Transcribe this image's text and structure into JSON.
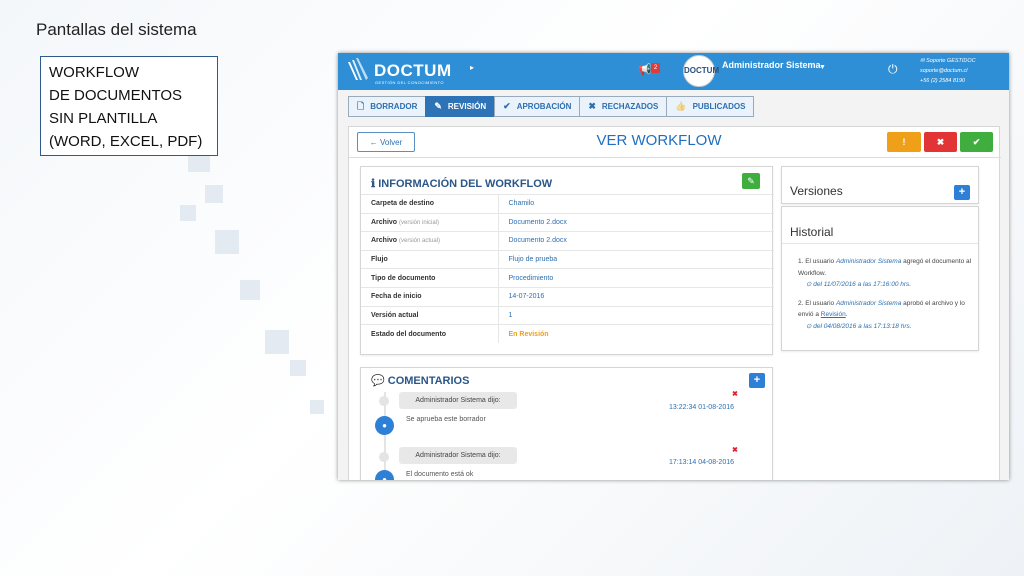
{
  "slide": {
    "title": "Pantallas del sistema",
    "caption": [
      "WORKFLOW",
      "DE DOCUMENTOS",
      "SIN PLANTILLA",
      "(WORD, EXCEL, PDF)"
    ]
  },
  "navbar": {
    "logo_text": "DOCTUM",
    "logo_sub": "GESTIÓN DEL CONOCIMIENTO",
    "notification_count": "2",
    "avatar_text": "DOCTUM",
    "user_name": "Administrador Sistema",
    "support_title": "Soporte GESTIDOC",
    "support_email": "soporte@doctum.cl",
    "support_phone": "+56 (2) 2584 8190",
    "color": "#2e8fd6"
  },
  "tabs": [
    {
      "label": "BORRADOR",
      "icon": "file-icon",
      "glyph": "🗋"
    },
    {
      "label": "REVISIÓN",
      "icon": "edit-icon",
      "glyph": "✎"
    },
    {
      "label": "APROBACIÓN",
      "icon": "check-icon",
      "glyph": "✔"
    },
    {
      "label": "RECHAZADOS",
      "icon": "x-icon",
      "glyph": "✖"
    },
    {
      "label": "PUBLICADOS",
      "icon": "thumbs-up-icon",
      "glyph": "👍"
    }
  ],
  "toolbar": {
    "back_label": "Volver",
    "page_title": "VER WORKFLOW",
    "warn_glyph": "!",
    "reject_glyph": "✖",
    "approve_glyph": "✔"
  },
  "info": {
    "title": "INFORMACIÓN DEL WORKFLOW",
    "rows": [
      {
        "key": "Carpeta de destino",
        "note": "",
        "value": "Chamilo"
      },
      {
        "key": "Archivo",
        "note": "(versión inicial)",
        "value": "Documento 2.docx"
      },
      {
        "key": "Archivo",
        "note": "(versión actual)",
        "value": "Documento 2.docx"
      },
      {
        "key": "Flujo",
        "note": "",
        "value": "Flujo de prueba"
      },
      {
        "key": "Tipo de documento",
        "note": "",
        "value": "Procedimiento"
      },
      {
        "key": "Fecha de inicio",
        "note": "",
        "value": "14-07-2016"
      },
      {
        "key": "Versión actual",
        "note": "",
        "value": "1"
      },
      {
        "key": "Estado del documento",
        "note": "",
        "value": "En Revisión"
      }
    ]
  },
  "comments": {
    "title": "COMENTARIOS",
    "items": [
      {
        "author": "Administrador Sistema dijo:",
        "text": "Se aprueba este borrador",
        "time": "13:22:34 01-08-2016"
      },
      {
        "author": "Administrador Sistema dijo:",
        "text": "El documento está ok",
        "time": "17:13:14 04-08-2016"
      }
    ]
  },
  "versions": {
    "title": "Versiones"
  },
  "historial": {
    "title": "Historial",
    "items": [
      {
        "pre": "1. El usuario ",
        "user": "Administrador Sistema",
        "post": " agregó el documento al Workflow.",
        "link": "",
        "end": "",
        "date": "del 11/07/2016 a las 17:16:00 hrs."
      },
      {
        "pre": "2. El usuario ",
        "user": "Administrador Sistema",
        "post": " aprobó el archivo y lo envió a ",
        "link": "Revisión",
        "end": ".",
        "date": "del 04/08/2016 a las 17:13:18 hrs."
      }
    ]
  }
}
